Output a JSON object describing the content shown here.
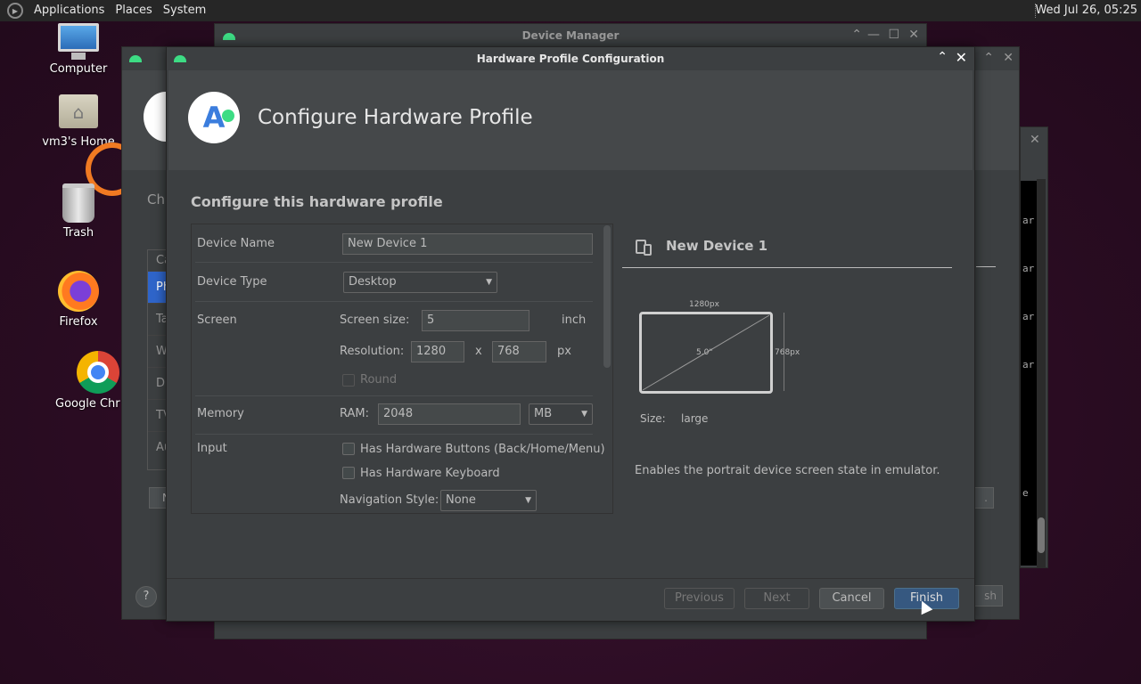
{
  "top_panel": {
    "menus": [
      "Applications",
      "Places",
      "System"
    ],
    "clock": "Wed Jul 26, 05:25"
  },
  "desktop": {
    "icons": [
      {
        "label": "Computer",
        "icon": "computer-icon"
      },
      {
        "label": "vm3's Home",
        "icon": "home-folder-icon"
      },
      {
        "label": "Trash",
        "icon": "trash-icon"
      },
      {
        "label": "Firefox",
        "icon": "firefox-icon"
      },
      {
        "label": "Google Chr",
        "icon": "chrome-icon"
      }
    ]
  },
  "background_windows": {
    "device_manager_title": "Device Manager",
    "behind_heading": "Ch",
    "behind_list": [
      "Ca",
      "Ph",
      "Ta",
      "W",
      "D",
      "TV",
      "Au"
    ],
    "behind_button_left": "N",
    "behind_button_right": "sh",
    "behind_button_right2": ".",
    "term_lines": [
      "ar",
      "ar",
      "ar",
      "ar",
      "e"
    ]
  },
  "dialog": {
    "title": "Hardware Profile Configuration",
    "header_title": "Configure Hardware Profile",
    "section_title": "Configure this hardware profile",
    "form": {
      "device_name_label": "Device Name",
      "device_name_value": "New Device 1",
      "device_type_label": "Device Type",
      "device_type_value": "Desktop",
      "screen_label": "Screen",
      "screen_size_label": "Screen size:",
      "screen_size_value": "5",
      "screen_size_unit": "inch",
      "resolution_label": "Resolution:",
      "resolution_width": "1280",
      "resolution_sep": "x",
      "resolution_height": "768",
      "resolution_unit": "px",
      "round_label": "Round",
      "round_checked": false,
      "memory_label": "Memory",
      "ram_label": "RAM:",
      "ram_value": "2048",
      "ram_unit": "MB",
      "input_label": "Input",
      "hw_buttons_label": "Has Hardware Buttons (Back/Home/Menu)",
      "hw_buttons_checked": false,
      "hw_keyboard_label": "Has Hardware Keyboard",
      "hw_keyboard_checked": false,
      "nav_style_label": "Navigation Style:",
      "nav_style_value": "None"
    },
    "preview": {
      "title": "New Device 1",
      "width_label": "1280px",
      "height_label": "768px",
      "diagonal_label": "5.0\"",
      "size_key": "Size:",
      "size_value": "large",
      "description": "Enables the portrait device screen state in emulator."
    },
    "buttons": {
      "previous": "Previous",
      "next": "Next",
      "cancel": "Cancel",
      "finish": "Finish",
      "help": "?"
    }
  },
  "colors": {
    "accent": "#365880",
    "panel_bg": "#3c3f41",
    "header_bg": "#45484a",
    "android_green": "#3ddc84"
  }
}
